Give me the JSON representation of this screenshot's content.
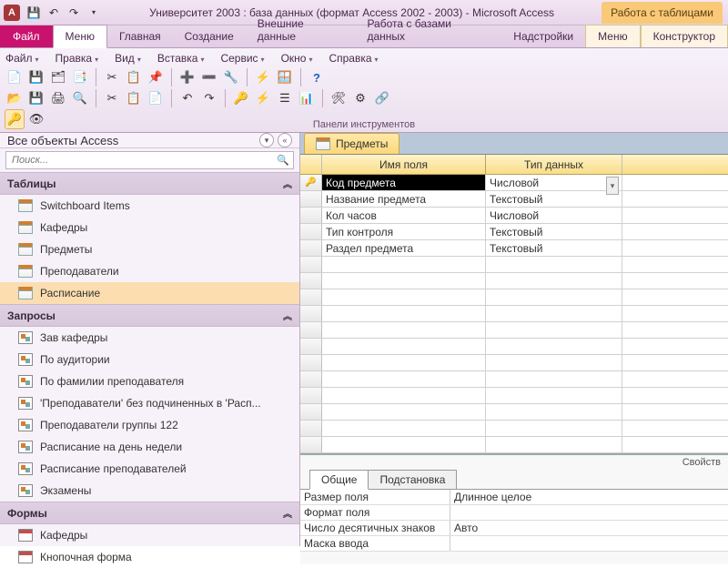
{
  "titlebar": {
    "app_letter": "A",
    "title": "Университет 2003 : база данных (формат Access 2002 - 2003)  -  Microsoft Access",
    "context_label": "Работа с таблицами"
  },
  "ribbon_tabs": {
    "file": "Файл",
    "items": [
      "Меню",
      "Главная",
      "Создание",
      "Внешние данные",
      "Работа с базами данных",
      "Надстройки"
    ],
    "ctx": [
      "Меню",
      "Конструктор"
    ]
  },
  "ribbon_menu": {
    "row": [
      "Файл",
      "Правка",
      "Вид",
      "Вставка",
      "Сервис",
      "Окно",
      "Справка"
    ],
    "panel_label": "Панели инструментов"
  },
  "nav": {
    "title": "Все объекты Access",
    "search_ph": "Поиск...",
    "groups": {
      "tables": {
        "label": "Таблицы",
        "items": [
          "Switchboard Items",
          "Кафедры",
          "Предметы",
          "Преподаватели",
          "Расписание"
        ]
      },
      "queries": {
        "label": "Запросы",
        "items": [
          "Зав кафедры",
          "По аудитории",
          "По фамилии преподавателя",
          "'Преподаватели' без подчиненных в 'Расп...",
          "Преподаватели группы 122",
          "Расписание на день недели",
          "Расписание преподавателей",
          "Экзамены"
        ]
      },
      "forms": {
        "label": "Формы",
        "items": [
          "Кафедры",
          "Кнопочная форма"
        ]
      }
    }
  },
  "doc": {
    "tab": "Предметы",
    "headers": {
      "field": "Имя поля",
      "type": "Тип данных"
    },
    "rows": [
      {
        "name": "Код предмета",
        "type": "Числовой",
        "pk": true
      },
      {
        "name": "Название предмета",
        "type": "Текстовый"
      },
      {
        "name": "Кол часов",
        "type": "Числовой"
      },
      {
        "name": "Тип контроля",
        "type": "Текстовый"
      },
      {
        "name": "Раздел предмета",
        "type": "Текстовый"
      }
    ]
  },
  "props": {
    "section": "Свойств",
    "tabs": {
      "general": "Общие",
      "lookup": "Подстановка"
    },
    "rows": [
      {
        "n": "Размер поля",
        "v": "Длинное целое"
      },
      {
        "n": "Формат поля",
        "v": ""
      },
      {
        "n": "Число десятичных знаков",
        "v": "Авто"
      },
      {
        "n": "Маска ввода",
        "v": ""
      }
    ]
  }
}
